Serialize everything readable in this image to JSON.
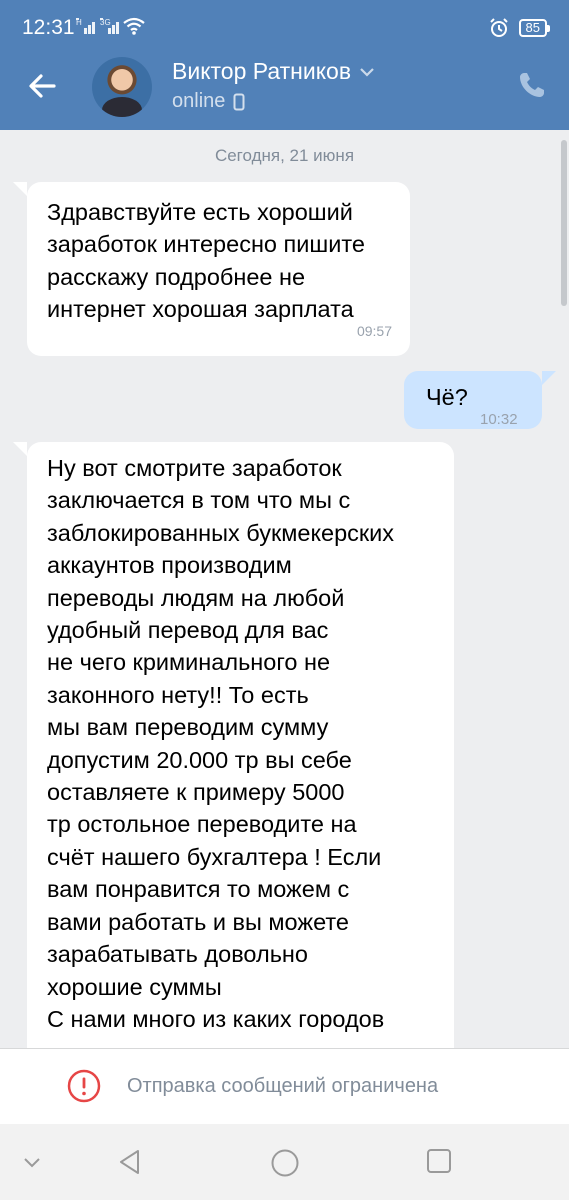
{
  "status_bar": {
    "time": "12:31",
    "net_label_1": "H",
    "net_label_2": "3G",
    "battery": "85"
  },
  "header": {
    "contact_name": "Виктор Ратников",
    "contact_status": "online"
  },
  "chat": {
    "date_separator": "Сегодня, 21 июня",
    "messages": [
      {
        "direction": "incoming",
        "text": "Здравствуйте есть хороший заработок интересно пишите расскажу подробнее не интернет хорошая зарплата",
        "time": "09:57"
      },
      {
        "direction": "outgoing",
        "text": "Чё?",
        "time": "10:32"
      },
      {
        "direction": "incoming",
        "text_lines": [
          "Ну вот смотрите заработок",
          "заключается в том что мы с",
          "заблокированных букмекерских",
          "аккаунтов производим",
          "переводы людям на любой",
          "удобный перевод для вас",
          "не чего криминального не",
          "законного нету!! То есть",
          "мы вам переводим сумму",
          "допустим 20.000 тр вы себе",
          "оставляете к примеру 5000",
          "тр остольное переводите на",
          "счёт нашего бухгалтера ! Если",
          "вам понравится то можем с",
          "вами работать и вы можете",
          "зарабатывать довольно",
          "хорошие суммы",
          "С нами много из каких городов"
        ]
      }
    ]
  },
  "restriction": {
    "text": "Отправка сообщений ограничена"
  },
  "colors": {
    "header": "#5181b8",
    "background": "#edeef0",
    "outgoing_bubble": "#cce4ff",
    "incoming_bubble": "#ffffff",
    "warning": "#e64646"
  },
  "icons": [
    "back-arrow-icon",
    "chevron-down-icon",
    "mobile-phone-icon",
    "phone-call-icon",
    "warning-icon",
    "nav-collapse-icon",
    "nav-back-icon",
    "nav-home-icon",
    "nav-recents-icon",
    "alarm-icon",
    "wifi-icon",
    "signal-icon"
  ]
}
